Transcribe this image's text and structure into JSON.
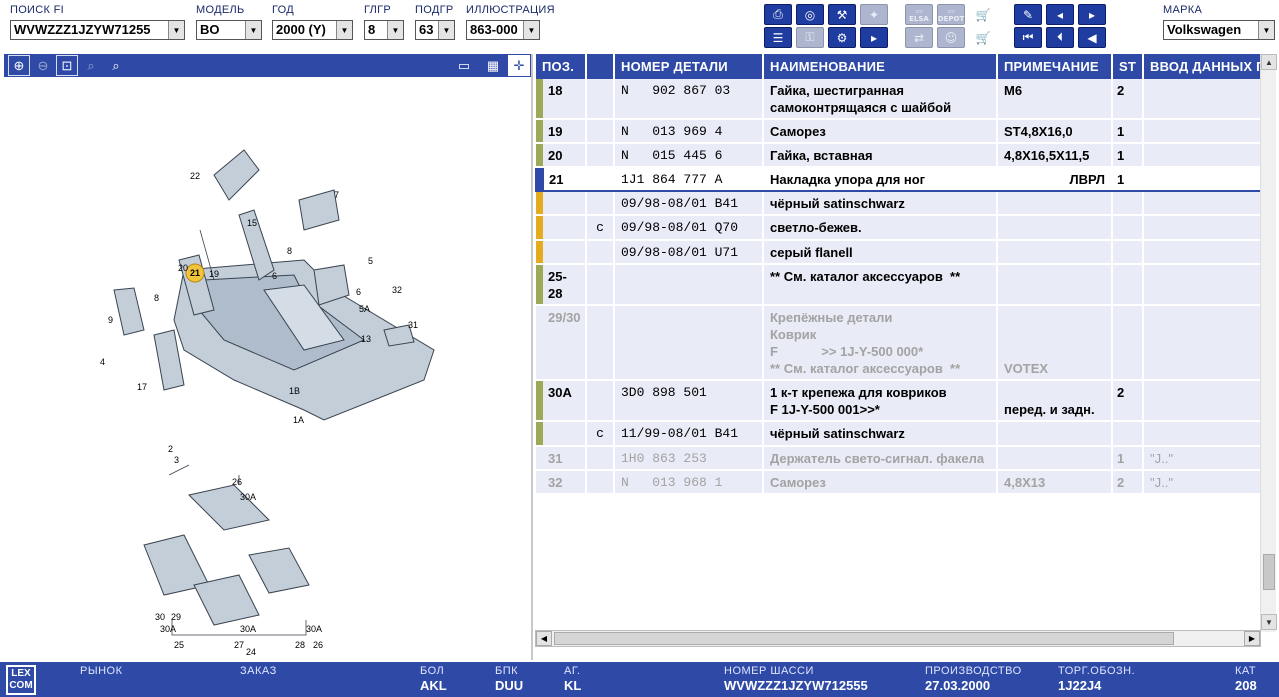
{
  "toolbar": {
    "search": {
      "label": "ПОИСК FI",
      "value": "WVWZZZ1JZYW71255"
    },
    "model": {
      "label": "МОДЕЛЬ",
      "value": "BO"
    },
    "year": {
      "label": "ГОД",
      "value": "2000 (Y)"
    },
    "mgroup": {
      "label": "ГЛГР",
      "value": "8"
    },
    "subgroup": {
      "label": "ПОДГР",
      "value": "63"
    },
    "illustration": {
      "label": "ИЛЛЮСТРАЦИЯ",
      "value": "863-000"
    },
    "brand": {
      "label": "МАРКА",
      "value": "Volkswagen"
    },
    "elsa_label": "ELSA",
    "depot_label": "DEPOT"
  },
  "table": {
    "headers": [
      "ПОЗ.",
      "",
      "НОМЕР ДЕТАЛИ",
      "НАИМЕНОВАНИЕ",
      "ПРИМЕЧАНИЕ",
      "ST",
      "ВВОД ДАННЫХ П"
    ],
    "rows": [
      {
        "pos": "18",
        "c": "",
        "part": "N   902 867 03",
        "name": "Гайка, шестигранная самоконтрящаяся с шайбой",
        "note": "M6",
        "st": "2",
        "input": "",
        "mark": "#9aaa57",
        "state": "normal"
      },
      {
        "pos": "19",
        "c": "",
        "part": "N   013 969 4",
        "name": "Саморез",
        "note": "ST4,8X16,0",
        "st": "1",
        "input": "",
        "mark": "#9aaa57",
        "state": "normal"
      },
      {
        "pos": "20",
        "c": "",
        "part": "N   015 445 6",
        "name": "Гайка, вставная",
        "note": "4,8X16,5X11,5",
        "st": "1",
        "input": "",
        "mark": "#9aaa57",
        "state": "normal"
      },
      {
        "pos": "21",
        "c": "",
        "part": "1J1 864 777 A",
        "name": "Накладка упора для ног",
        "note": "ЛВРЛ",
        "st": "1",
        "input": "",
        "mark": "#2f4aa6",
        "state": "selected"
      },
      {
        "pos": "",
        "c": "",
        "part": "09/98-08/01 B41",
        "name": "чёрный satinschwarz",
        "note": "",
        "st": "",
        "input": "",
        "mark": "#e5ab1e",
        "state": "normal"
      },
      {
        "pos": "",
        "c": "c",
        "part": "09/98-08/01 Q70",
        "name": "светло-бежев.",
        "note": "",
        "st": "",
        "input": "",
        "mark": "#e5ab1e",
        "state": "normal"
      },
      {
        "pos": "",
        "c": "",
        "part": "09/98-08/01 U71",
        "name": "серый flanell",
        "note": "",
        "st": "",
        "input": "",
        "mark": "#e5ab1e",
        "state": "normal"
      },
      {
        "pos": "25-28",
        "c": "",
        "part": "",
        "name": "** См. каталог аксессуаров  **",
        "note": "",
        "st": "",
        "input": "",
        "mark": "#9aaa57",
        "state": "normal"
      },
      {
        "pos": "29/30",
        "c": "",
        "part": "",
        "name": "Крепёжные детали\nКоврик\nF            >> 1J-Y-500 000*\n** См. каталог аксессуаров  **",
        "note": "\n\n\nVOTEX",
        "st": "",
        "input": "",
        "mark": "",
        "state": "grey"
      },
      {
        "pos": "30A",
        "c": "",
        "part": "3D0 898 501",
        "name": "1 к-т крепежа для ковриков\nF 1J-Y-500 001>>*",
        "note": "\nперед. и задн.",
        "st": "2",
        "input": "",
        "mark": "#9aaa57",
        "state": "normal"
      },
      {
        "pos": "",
        "c": "c",
        "part": "11/99-08/01 B41",
        "name": "чёрный satinschwarz",
        "note": "",
        "st": "",
        "input": "",
        "mark": "#9aaa57",
        "state": "normal"
      },
      {
        "pos": "31",
        "c": "",
        "part": "1H0 863 253",
        "name": "Держатель свето-сигнал. факела",
        "note": "",
        "st": "1",
        "input": "\"J..\"",
        "mark": "",
        "state": "grey"
      },
      {
        "pos": "32",
        "c": "",
        "part": "N   013 968 1",
        "name": "Саморез",
        "note": "4,8X13",
        "st": "2",
        "input": "\"J..\"",
        "mark": "",
        "state": "grey"
      }
    ]
  },
  "illustration": {
    "callouts": [
      "22",
      "7",
      "15",
      "8",
      "5",
      "20",
      "21",
      "19",
      "6",
      "6",
      "32",
      "8",
      "5A",
      "31",
      "9",
      "13",
      "4",
      "1B",
      "17",
      "1A",
      "2",
      "3",
      "26",
      "30A",
      "30",
      "29",
      "30A",
      "30A",
      "25",
      "27",
      "28",
      "26",
      "24"
    ]
  },
  "status": {
    "logo": "LEX COM",
    "market": {
      "label": "РЫНОК",
      "value": ""
    },
    "order": {
      "label": "ЗАКАЗ",
      "value": ""
    },
    "bol": {
      "label": "БОЛ",
      "value": "AKL"
    },
    "bpk": {
      "label": "БПК",
      "value": "DUU"
    },
    "ag": {
      "label": "АГ.",
      "value": "KL"
    },
    "chassis": {
      "label": "НОМЕР ШАССИ",
      "value": "WVWZZZ1JZYW712555"
    },
    "production": {
      "label": "ПРОИЗВОДСТВО",
      "value": "27.03.2000"
    },
    "trade": {
      "label": "ТОРГ.ОБОЗН.",
      "value": "1J22J4"
    },
    "cat": {
      "label": "КАТ",
      "value": "208"
    }
  }
}
